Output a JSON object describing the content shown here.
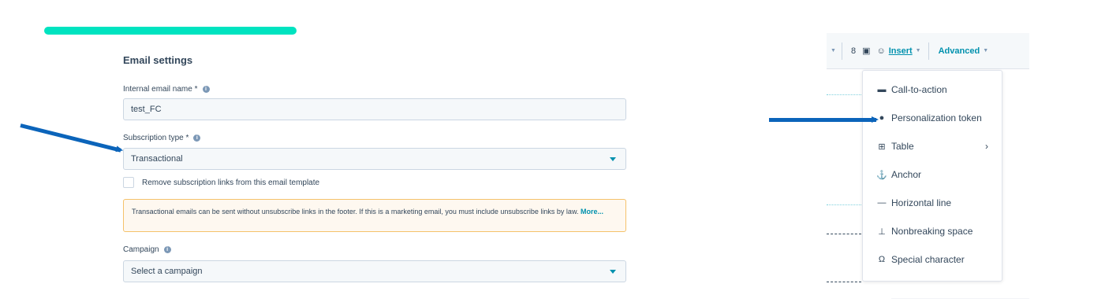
{
  "email_settings": {
    "title": "Email settings",
    "internal_name": {
      "label": "Internal email name *",
      "value": "test_FC"
    },
    "subscription_type": {
      "label": "Subscription type *",
      "value": "Transactional"
    },
    "remove_links_label": "Remove subscription links from this email template",
    "note": {
      "text": "Transactional emails can be sent without unsubscribe links in the footer. If this is a marketing email, you must include unsubscribe links by law.",
      "more_link": "More..."
    },
    "campaign": {
      "label": "Campaign",
      "placeholder": "Select a campaign"
    }
  },
  "toolbar": {
    "insert_label": "Insert",
    "advanced_label": "Advanced"
  },
  "insert_menu": {
    "items": [
      {
        "label": "Call-to-action",
        "icon": "cta-icon"
      },
      {
        "label": "Personalization token",
        "icon": "person-icon"
      },
      {
        "label": "Table",
        "icon": "table-icon"
      },
      {
        "label": "Anchor",
        "icon": "anchor-icon"
      },
      {
        "label": "Horizontal line",
        "icon": "horizontal-line-icon"
      },
      {
        "label": "Nonbreaking space",
        "icon": "nonbreaking-space-icon"
      },
      {
        "label": "Special character",
        "icon": "omega-icon"
      }
    ]
  },
  "colors": {
    "accent_teal": "#00e3c0",
    "link": "#0091ae",
    "arrow": "#0b64ba",
    "text": "#33475b"
  }
}
